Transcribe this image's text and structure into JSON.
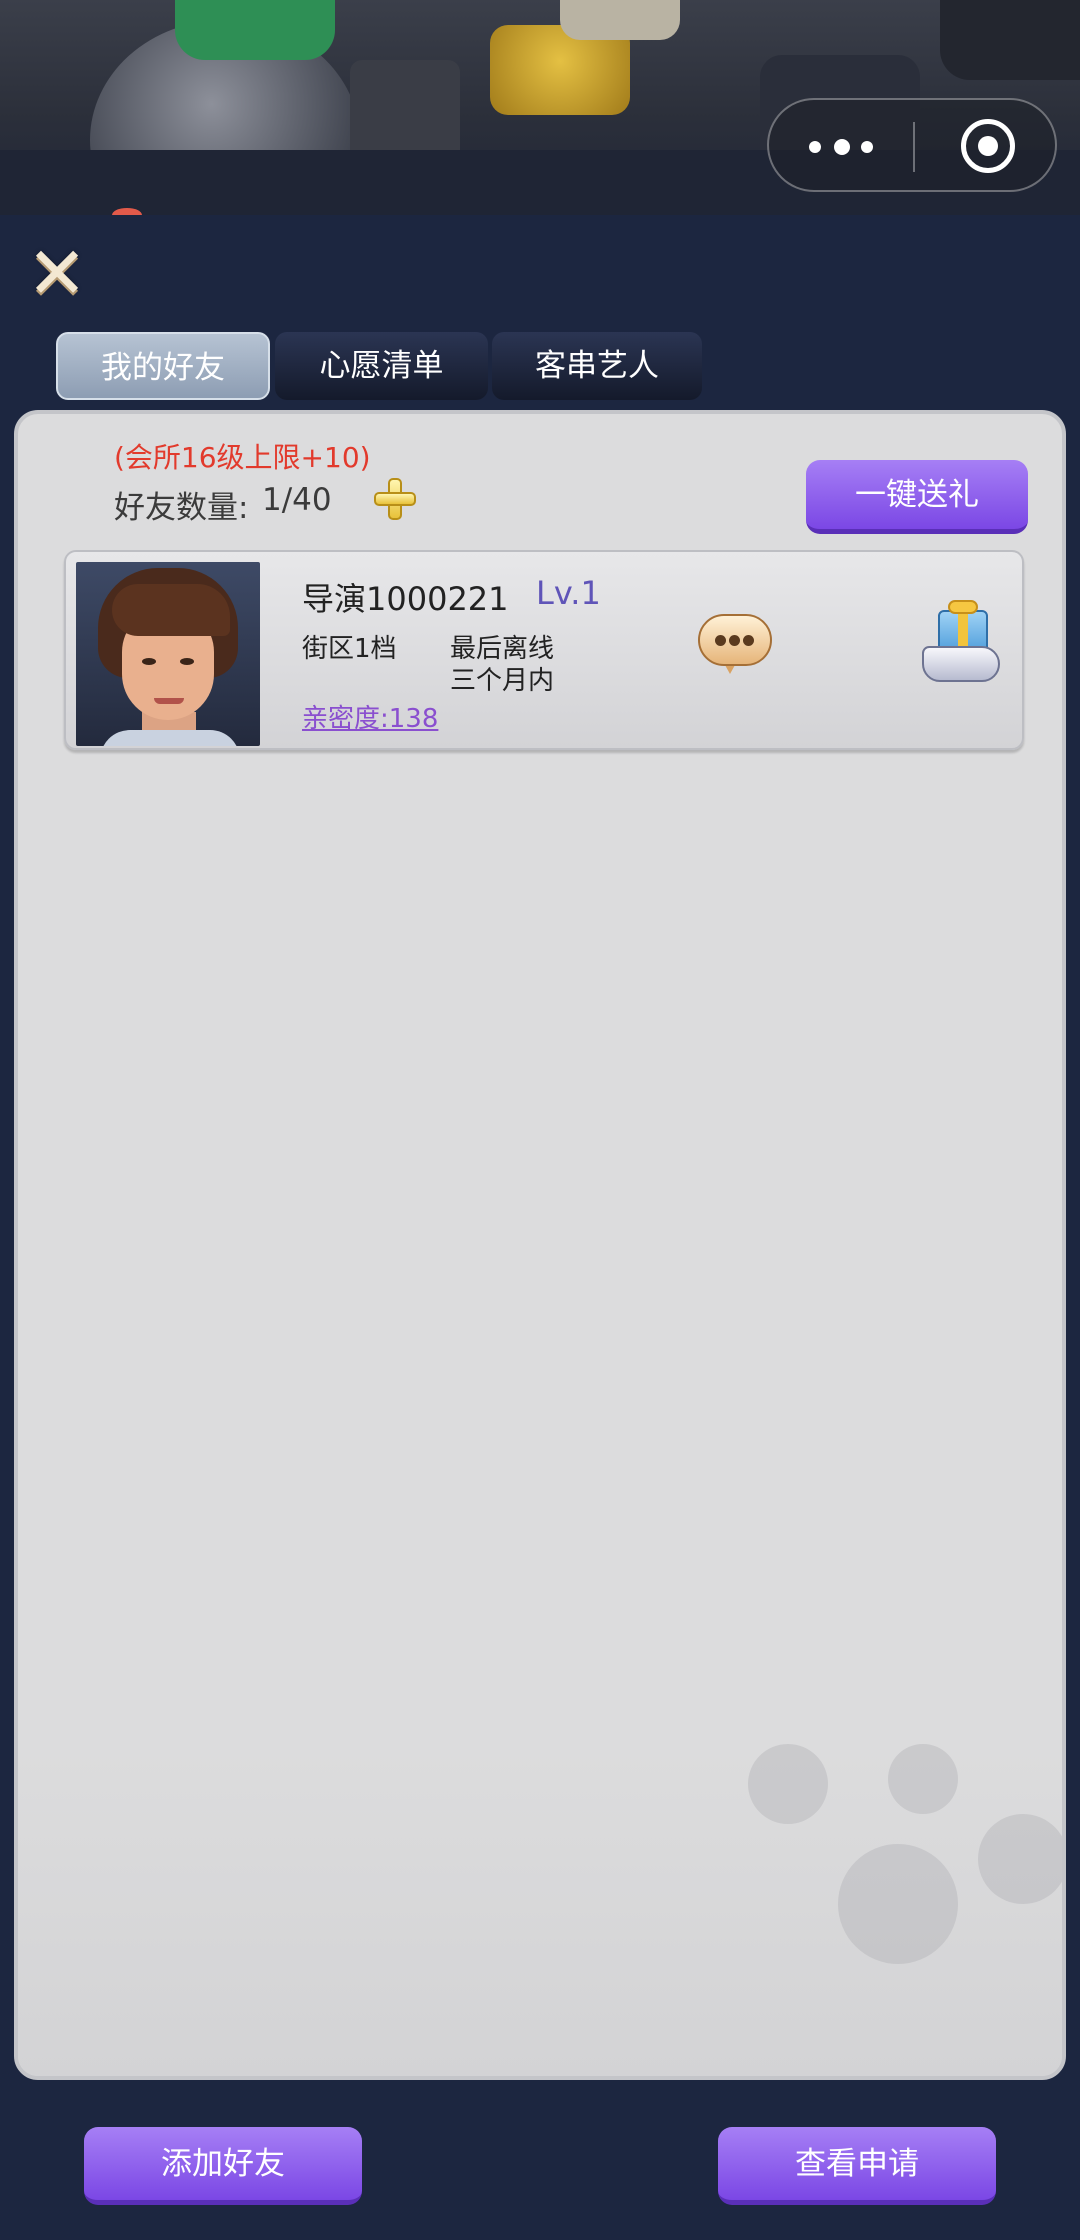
{
  "header": {
    "capsule": {
      "more_icon": "more-dots-icon",
      "close_icon": "target-circle-icon"
    },
    "close_icon": "close-x-icon"
  },
  "tabs": [
    {
      "label": "我的好友",
      "active": true
    },
    {
      "label": "心愿清单",
      "active": false
    },
    {
      "label": "客串艺人",
      "active": false
    }
  ],
  "friends_panel": {
    "limit_note": "(会所16级上限+10)",
    "count_label": "好友数量:",
    "count_value": "1/40",
    "add_capacity_icon": "plus-icon",
    "gift_all_label": "一键送礼",
    "friends": [
      {
        "name": "导演1000221",
        "level": "Lv.1",
        "district": "街区1档",
        "last_offline_label": "最后离线",
        "last_offline_value": "三个月内",
        "intimacy": "亲密度:138",
        "chat_icon": "chat-bubble-icon",
        "gift_icon": "gift-hand-icon"
      }
    ]
  },
  "footer": {
    "add_friend_label": "添加好友",
    "view_requests_label": "查看申请"
  },
  "colors": {
    "background": "#1c2640",
    "panel": "#dcdcdd",
    "purple_button": "#8b5cf0",
    "limit_text": "#e23a2c",
    "level_text": "#5f54b8",
    "intimacy_text": "#8a4fcf"
  }
}
